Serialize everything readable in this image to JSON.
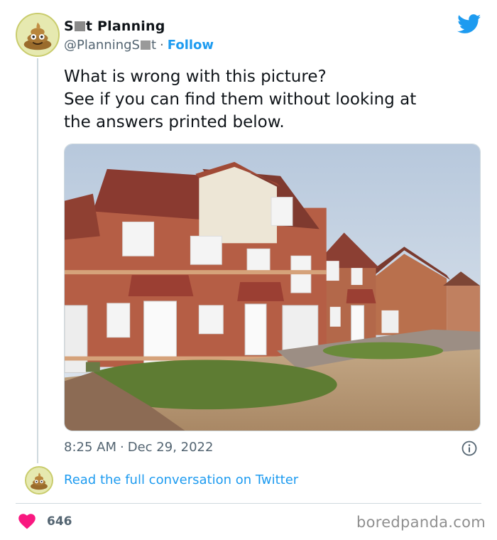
{
  "author": {
    "name_prefix": "S",
    "name_suffix": "t Planning",
    "handle_prefix": "@PlanningS",
    "handle_suffix": "t",
    "follow_label": "Follow",
    "separator": "·",
    "avatar_icon": "poop-emoji-icon"
  },
  "tweet": {
    "lines": [
      "What is wrong with this picture?",
      "See if you can find them without looking at",
      "the answers printed below."
    ],
    "time": "8:25 AM",
    "separator": "·",
    "date": "Dec 29, 2022"
  },
  "footer": {
    "read_link": "Read the full conversation on Twitter",
    "like_count": "646"
  },
  "watermark": "boredpanda.com",
  "colors": {
    "accent": "#1d9bf0",
    "like": "#f91880",
    "muted": "#536471",
    "divider": "#cfd9de"
  }
}
